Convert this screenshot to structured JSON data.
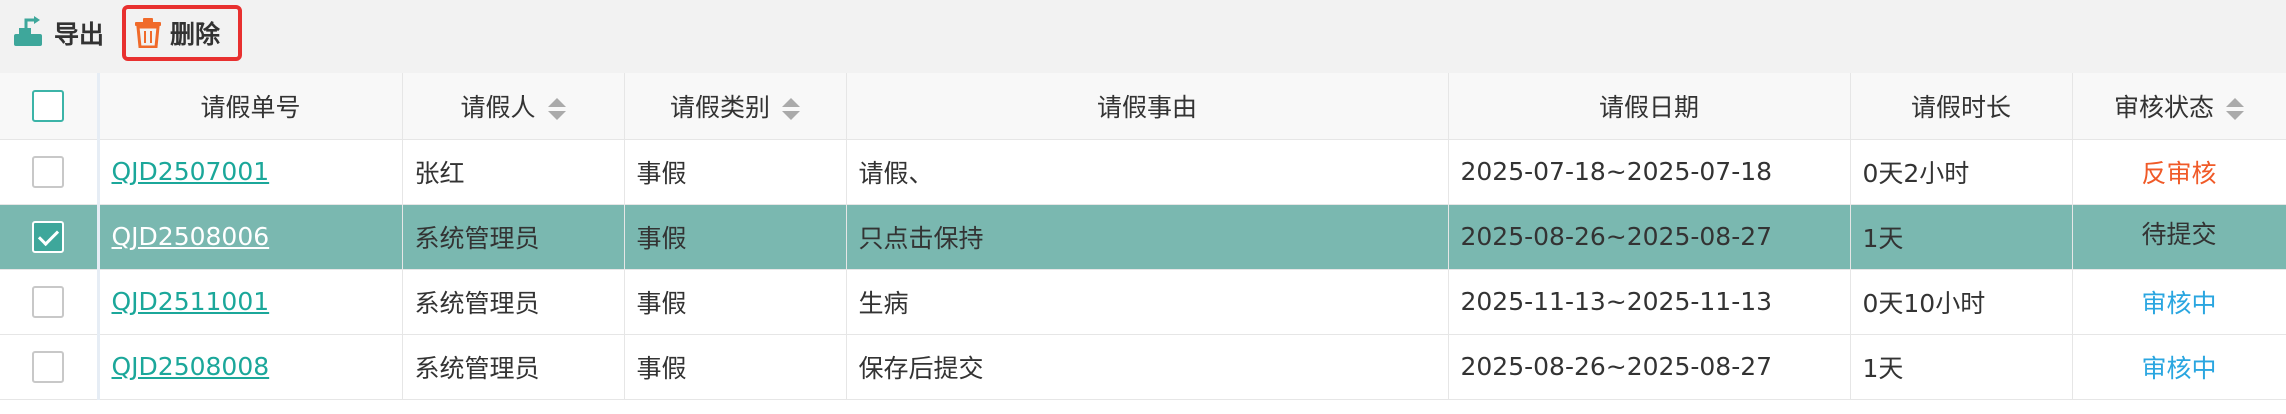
{
  "toolbar": {
    "export_label": "导出",
    "delete_label": "删除"
  },
  "table": {
    "headers": [
      "请假单号",
      "请假人",
      "请假类别",
      "请假事由",
      "请假日期",
      "请假时长",
      "审核状态"
    ],
    "rows": [
      {
        "id": "QJD2507001",
        "person": "张红",
        "type": "事假",
        "reason": "请假、",
        "date": "2025-07-18~2025-07-18",
        "duration": "0天2小时",
        "status": "反审核",
        "selected": false
      },
      {
        "id": "QJD2508006",
        "person": "系统管理员",
        "type": "事假",
        "reason": "只点击保持",
        "date": "2025-08-26~2025-08-27",
        "duration": "1天",
        "status": "待提交",
        "selected": true
      },
      {
        "id": "QJD2511001",
        "person": "系统管理员",
        "type": "事假",
        "reason": "生病",
        "date": "2025-11-13~2025-11-13",
        "duration": "0天10小时",
        "status": "审核中",
        "selected": false
      },
      {
        "id": "QJD2508008",
        "person": "系统管理员",
        "type": "事假",
        "reason": "保存后提交",
        "date": "2025-08-26~2025-08-27",
        "duration": "1天",
        "status": "审核中",
        "selected": false
      }
    ]
  },
  "colors": {
    "accent": "#1ba79a",
    "selected_row": "#7ab8b0",
    "status_reverse": "#f05a28",
    "status_reviewing": "#2aa6e0",
    "delete_highlight": "#e8302f"
  },
  "icons": {
    "export": "export-icon",
    "delete": "trash-icon"
  }
}
